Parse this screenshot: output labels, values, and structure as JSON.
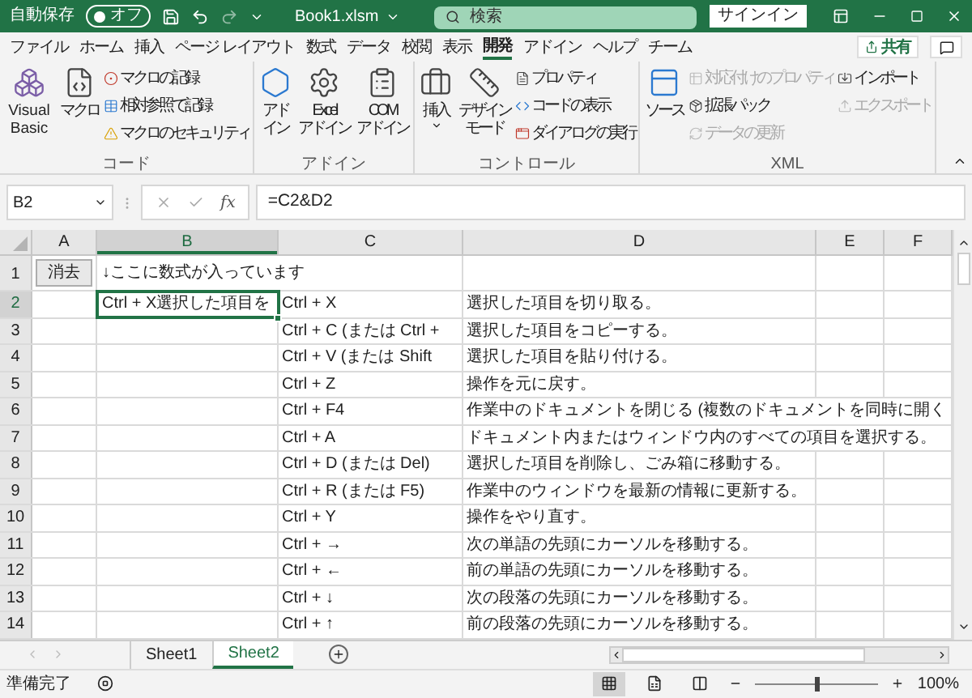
{
  "title_bar": {
    "autosave_label": "自動保存",
    "autosave_toggle": {
      "label": "オフ",
      "on": false
    },
    "file_name": "Book1.xlsm",
    "search": {
      "placeholder": "検索"
    },
    "sign_in": "サインイン"
  },
  "ribbon_tabs": [
    {
      "label": "ファイル",
      "selected": false
    },
    {
      "label": "ホーム",
      "selected": false
    },
    {
      "label": "挿入",
      "selected": false
    },
    {
      "label": "ページ レイアウト",
      "selected": false
    },
    {
      "label": "数式",
      "selected": false
    },
    {
      "label": "データ",
      "selected": false
    },
    {
      "label": "校閲",
      "selected": false
    },
    {
      "label": "表示",
      "selected": false
    },
    {
      "label": "開発",
      "selected": true
    },
    {
      "label": "アドイン",
      "selected": false
    },
    {
      "label": "ヘルプ",
      "selected": false
    },
    {
      "label": "チーム",
      "selected": false
    }
  ],
  "share_button": "共有",
  "ribbon_groups": [
    {
      "label": "コード",
      "large": [
        {
          "lines": [
            "Visual Basic"
          ],
          "dropdown": false
        },
        {
          "lines": [
            "マクロ"
          ],
          "dropdown": false
        }
      ],
      "small": [
        {
          "label": "マクロの記録",
          "disabled": false
        },
        {
          "label": "相対参照で記録",
          "disabled": false
        },
        {
          "label": "マクロのセキュリティ",
          "disabled": false
        }
      ]
    },
    {
      "label": "アドイン",
      "large": [
        {
          "lines": [
            "アド",
            "イン"
          ],
          "dropdown": false
        },
        {
          "lines": [
            "Excel",
            "アドイン"
          ],
          "dropdown": false
        },
        {
          "lines": [
            "COM",
            "アドイン"
          ],
          "dropdown": false
        }
      ]
    },
    {
      "label": "コントロール",
      "large": [
        {
          "lines": [
            "挿入"
          ],
          "dropdown": true
        },
        {
          "lines": [
            "デザイン",
            "モード"
          ],
          "dropdown": false
        }
      ],
      "small": [
        {
          "label": "プロパティ",
          "disabled": false
        },
        {
          "label": "コードの表示",
          "disabled": false
        },
        {
          "label": "ダイアログの実行",
          "disabled": false
        }
      ]
    },
    {
      "label": "XML",
      "large": [
        {
          "lines": [
            "ソース"
          ],
          "dropdown": false
        }
      ],
      "small": [
        {
          "label": "対応付けのプロパティ",
          "disabled": true
        },
        {
          "label": "拡張パック",
          "disabled": false
        },
        {
          "label": "データの更新",
          "disabled": true
        },
        {
          "label": "インポート",
          "disabled": false
        },
        {
          "label": "エクスポート",
          "disabled": true
        }
      ]
    }
  ],
  "formula_bar": {
    "name_box": "B2",
    "function_button": "fx",
    "formula": "=C2&D2"
  },
  "sheet": {
    "columns": [
      {
        "label": "A",
        "selected": false
      },
      {
        "label": "B",
        "selected": true
      },
      {
        "label": "C",
        "selected": false
      },
      {
        "label": "D",
        "selected": false
      },
      {
        "label": "E",
        "selected": false
      },
      {
        "label": "F",
        "selected": false
      }
    ],
    "first_row": {
      "number": "1",
      "selected": false,
      "button": "消去",
      "note": "↓ここに数式が入っています"
    },
    "rows": [
      {
        "number": "2",
        "selected": true,
        "b": "Ctrl + X選択した項目を",
        "b_selected": true,
        "c": "Ctrl + X",
        "d": "選択した項目を切り取る。",
        "overflow": false
      },
      {
        "number": "3",
        "selected": false,
        "b_selected": false,
        "c": "Ctrl + C (または Ctrl +",
        "d": "選択した項目をコピーする。",
        "overflow": false
      },
      {
        "number": "4",
        "selected": false,
        "b_selected": false,
        "c": "Ctrl + V (または Shift",
        "d": "選択した項目を貼り付ける。",
        "overflow": false
      },
      {
        "number": "5",
        "selected": false,
        "b_selected": false,
        "c": "Ctrl + Z",
        "d": "操作を元に戻す。",
        "overflow": false
      },
      {
        "number": "6",
        "selected": false,
        "b_selected": false,
        "c": "Ctrl + F4",
        "d": "作業中のドキュメントを閉じる (複数のドキュメントを同時に開く",
        "overflow": true
      },
      {
        "number": "7",
        "selected": false,
        "b_selected": false,
        "c": "Ctrl + A",
        "d": "ドキュメント内またはウィンドウ内のすべての項目を選択する。",
        "overflow": true
      },
      {
        "number": "8",
        "selected": false,
        "b_selected": false,
        "c": "Ctrl + D (または Del)",
        "d": "選択した項目を削除し、ごみ箱に移動する。",
        "overflow": false
      },
      {
        "number": "9",
        "selected": false,
        "b_selected": false,
        "c": "Ctrl + R (または F5)",
        "d": "作業中のウィンドウを最新の情報に更新する。",
        "overflow": false
      },
      {
        "number": "10",
        "selected": false,
        "b_selected": false,
        "c": "Ctrl + Y",
        "d": "操作をやり直す。",
        "overflow": false
      },
      {
        "number": "11",
        "selected": false,
        "b_selected": false,
        "c": "Ctrl + →",
        "d": "次の単語の先頭にカーソルを移動する。",
        "overflow": false
      },
      {
        "number": "12",
        "selected": false,
        "b_selected": false,
        "c": "Ctrl + ←",
        "d": "前の単語の先頭にカーソルを移動する。",
        "overflow": false
      },
      {
        "number": "13",
        "selected": false,
        "b_selected": false,
        "c": "Ctrl + ↓",
        "d": "次の段落の先頭にカーソルを移動する。",
        "overflow": false
      },
      {
        "number": "14",
        "selected": false,
        "b_selected": false,
        "c": "Ctrl + ↑",
        "d": "前の段落の先頭にカーソルを移動する。",
        "overflow": false
      }
    ]
  },
  "sheet_tabs": [
    {
      "label": "Sheet1",
      "selected": false
    },
    {
      "label": "Sheet2",
      "selected": true
    }
  ],
  "status_bar": {
    "text": "準備完了",
    "views": [
      {
        "selected": true
      },
      {
        "selected": false
      },
      {
        "selected": false
      }
    ],
    "zoom": {
      "level": 0.5,
      "label": "100%"
    }
  }
}
